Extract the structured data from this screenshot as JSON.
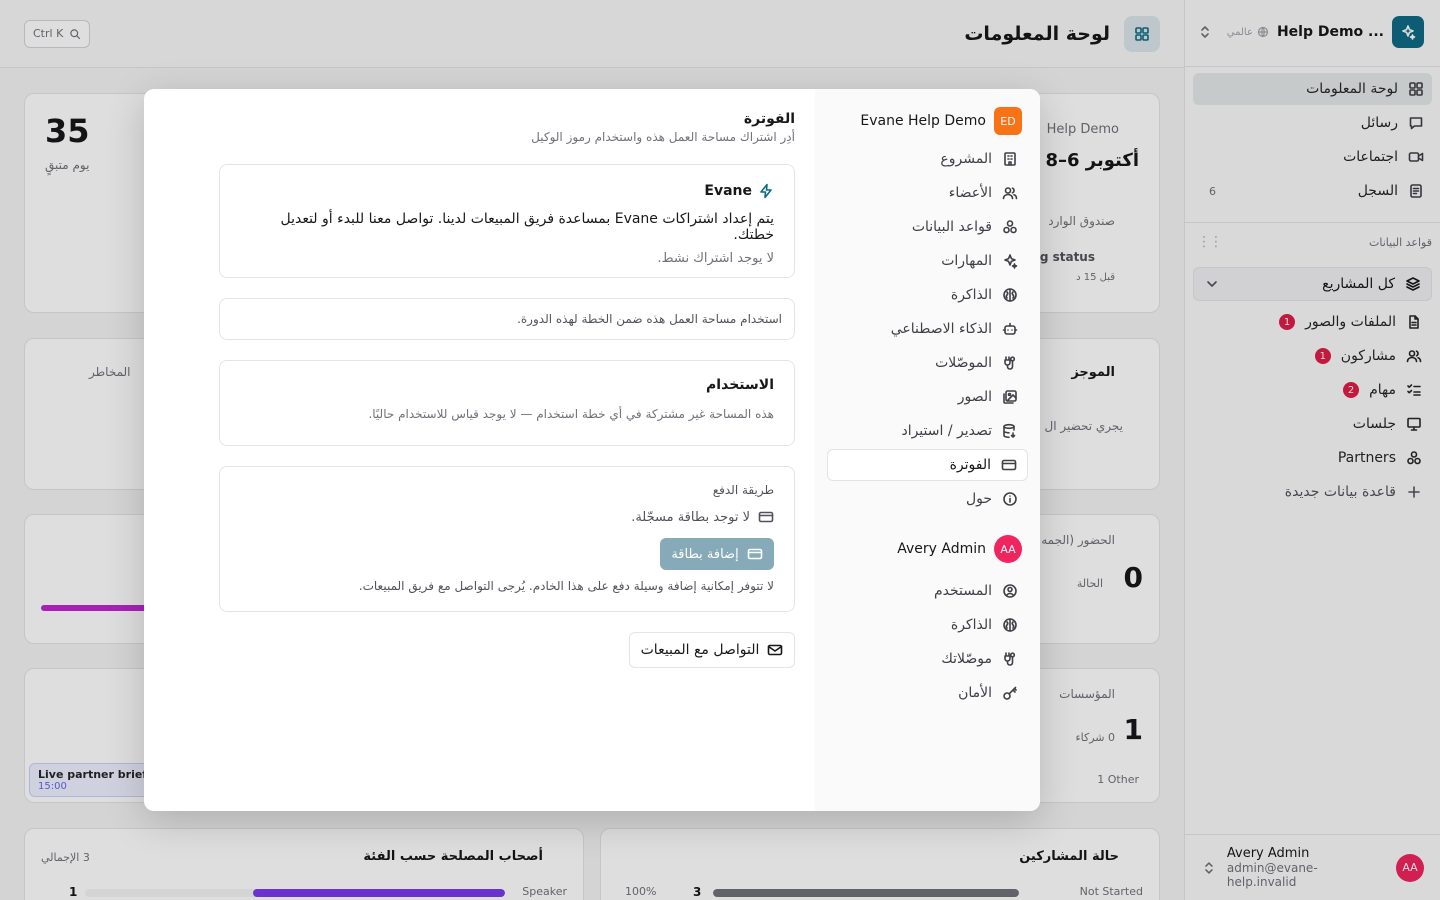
{
  "sidebar": {
    "workspace_name": "Help Demo ...",
    "workspace_scope": "عالمي",
    "nav": [
      {
        "label": "لوحة المعلومات",
        "icon": "dashboard-icon"
      },
      {
        "label": "رسائل",
        "icon": "message-icon"
      },
      {
        "label": "اجتماعات",
        "icon": "video-icon"
      },
      {
        "label": "السجل",
        "icon": "log-icon",
        "count": "6"
      }
    ],
    "databases_label": "قواعد البيانات",
    "all_projects": "كل المشاريع",
    "databases": [
      {
        "label": "الملفات والصور",
        "badge": "1"
      },
      {
        "label": "مشاركون",
        "badge": "1"
      },
      {
        "label": "مهام",
        "badge": "2"
      },
      {
        "label": "جلسات"
      },
      {
        "label": "Partners"
      }
    ],
    "new_database": "قاعدة بيانات جديدة",
    "user": {
      "initials": "AA",
      "name": "Avery Admin",
      "email": "admin@evane-help.invalid"
    }
  },
  "main": {
    "title": "لوحة المعلومات",
    "search_hint": "Ctrl K",
    "stat_days": "35",
    "stat_days_label": "يوم متبقٍ",
    "event_ws": "Help Demo",
    "event_date": "أكتوبر 6–8",
    "inbox_label": "صندوق الوارد",
    "status_label": "g status",
    "status_time": "قبل 15 د",
    "risks_label": "المخاطر",
    "summary_label": "الموجز",
    "summary_text": "يجري تحضير ال",
    "attendance_label": "الحضور (الجمه",
    "attendance_value": "0",
    "attendance_sub": "الحالة",
    "orgs_label": "المؤسسات",
    "orgs_value": "1",
    "orgs_sub": "0 شركاء",
    "orgs_other": "1 Other",
    "live_title": "Live partner briefi",
    "live_time": "15:00",
    "stakeholders_label": "أصحاب المصلحة حسب الفئة",
    "stakeholders_total": "3 الإجمالي",
    "stakeholders_row_count": "1",
    "stakeholders_row_label": "Speaker",
    "stakeholders_fill": 0.6,
    "participants_label": "حالة المشاركين",
    "participants_pct": "100%",
    "participants_count": "3",
    "participants_row_label": "Not Started",
    "participants_fill": 1.0
  },
  "modal": {
    "workspace_initials": "ED",
    "workspace_name": "Evane Help Demo",
    "workspace_nav": [
      {
        "label": "المشروع",
        "icon": "building-icon"
      },
      {
        "label": "الأعضاء",
        "icon": "users-icon"
      },
      {
        "label": "قواعد البيانات",
        "icon": "database-icon"
      },
      {
        "label": "المهارات",
        "icon": "sparkles-icon"
      },
      {
        "label": "الذاكرة",
        "icon": "brain-icon"
      },
      {
        "label": "الذكاء الاصطناعي",
        "icon": "bot-icon"
      },
      {
        "label": "الموصّلات",
        "icon": "plug-icon"
      },
      {
        "label": "الصور",
        "icon": "images-icon"
      },
      {
        "label": "تصدير / استيراد",
        "icon": "export-icon"
      },
      {
        "label": "الفوترة",
        "icon": "credit-card-icon",
        "active": true
      },
      {
        "label": "حول",
        "icon": "info-icon"
      }
    ],
    "user_initials": "AA",
    "user_name": "Avery Admin",
    "user_nav": [
      {
        "label": "المستخدم",
        "icon": "user-circle-icon"
      },
      {
        "label": "الذاكرة",
        "icon": "brain-icon"
      },
      {
        "label": "موصّلاتك",
        "icon": "plug-icon"
      },
      {
        "label": "الأمان",
        "icon": "key-icon"
      }
    ],
    "billing": {
      "title": "الفوترة",
      "subtitle": "أدِر اشتراك مساحة العمل هذه واستخدام رموز الوكيل",
      "plan_name": "Evane",
      "plan_desc": "يتم إعداد اشتراكات Evane بمساعدة فريق المبيعات لدينا. تواصل معنا للبدء أو لتعديل خطتك.",
      "plan_none": "لا يوجد اشتراك نشط.",
      "in_plan": "استخدام مساحة العمل هذه ضمن الخطة لهذه الدورة.",
      "usage_title": "الاستخدام",
      "usage_desc": "هذه المساحة غير مشتركة في أي خطة استخدام — لا يوجد قياس للاستخدام حاليًا.",
      "payment_label": "طريقة الدفع",
      "no_card": "لا توجد بطاقة مسجّلة.",
      "add_card": "إضافة بطاقة",
      "payment_note": "لا تتوفر إمكانية إضافة وسيلة دفع على هذا الخادم. يُرجى التواصل مع فريق المبيعات.",
      "contact_sales": "التواصل مع المبيعات"
    }
  }
}
